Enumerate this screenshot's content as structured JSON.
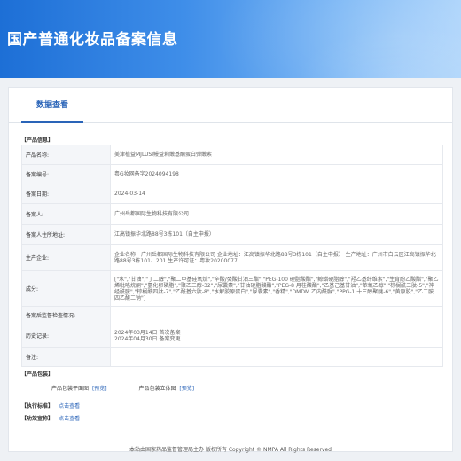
{
  "header": {
    "title": "国产普通化妆品备案信息"
  },
  "tabs": [
    {
      "label": "数据查看"
    }
  ],
  "sections": {
    "product_info": "【产品信息】",
    "packaging": "【产品包装】",
    "standard": "【执行标准】",
    "efficacy": "【功效宣称】"
  },
  "product_table": [
    {
      "key": "产品名称:",
      "value": "美津植益MJLUSI鳗益莉嫩基酮蛋白弹嫩素"
    },
    {
      "key": "备案编号:",
      "value": "粤G妆网备字2024094198"
    },
    {
      "key": "备案日期:",
      "value": "2024-03-14"
    },
    {
      "key": "备案人:",
      "value": "广州岳都国际生物科技有限公司"
    },
    {
      "key": "备案人住所地址:",
      "value": "江高镇振华北路88号3栋101（自主申报）"
    },
    {
      "key": "生产企业:",
      "value": "企业名称：广州岳都国际生物科技有限公司 企业地址：江高镇振华北路88号3栋101（自主申报） 生产地址：广州市白云区江高镇振华北路88号3栋101、201 生产许可证：粤妆20200077"
    },
    {
      "key": "成分:",
      "value": "[\"水\",\"甘油\",\"丁二醇\",\"聚二甲基硅氧烷\",\"辛酸/癸酸甘油三酯\",\"PEG-100 硬脂酸酯\",\"鲸蜡硬脂醇\",\"羟乙基纤维素\",\"生育酚乙酸酯\",\"聚乙烯吡咯烷酮\",\"氢化卵磷脂\",\"聚乙二醇-32\",\"尿囊素\",\"甘油硬脂酸酯\",\"PEG-8 月桂酸酯\",\"乙基己基甘油\",\"苯氧乙醇\",\"棕榈酰三肽-5\",\"神经酰胺\",\"棕榈酰四肽-7\",\"乙酰基六肽-8\",\"水解胶原蛋白\",\"尿囊素\",\"香精\",\"DMDM 乙内酰脲\",\"PPG-1 十三醇聚醚-6\",\"黄原胶\",\"乙二胺四乙酸二钠\"]"
    },
    {
      "key": "备案后监督检查情况:",
      "value": ""
    },
    {
      "key": "历史记录:",
      "value": "2024年03月14日 首次备案\n2024年04月30日 备案变更"
    },
    {
      "key": "备注:",
      "value": ""
    }
  ],
  "packaging": {
    "flat_label": "产品包装平面图",
    "flat_link": "[预览]",
    "solid_label": "产品包装立体图",
    "solid_link": "[预览]"
  },
  "standard_link": "点击查看",
  "efficacy_link": "点击查看",
  "footer": "本站由国家药品监督管理局主办 版权所有 Copyright © NMPA All Rights Reserved",
  "colors": {
    "header_start": "#1d6fd6",
    "header_end": "#a9d2fb",
    "accent": "#2a64b8"
  }
}
